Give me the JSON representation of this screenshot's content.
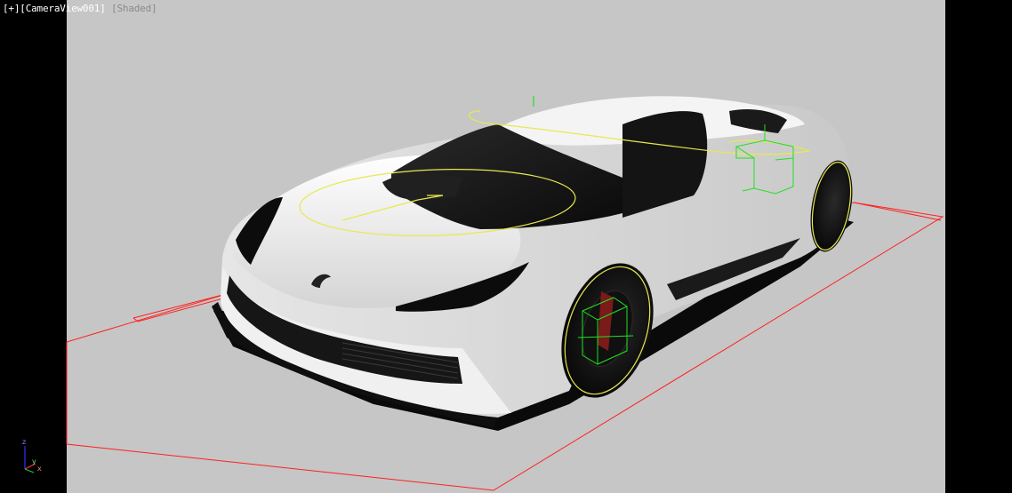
{
  "viewport": {
    "menu_plus": "[+]",
    "camera_name": "[CameraView001]",
    "shading_mode": "[Shaded]"
  },
  "axis_gizmo": {
    "x_label": "x",
    "y_label": "y",
    "z_label": "z"
  },
  "colors": {
    "viewport_background": "#c6c6c6",
    "outside_safe_frame": "#000000",
    "ground_helper": "#ff2020",
    "selected_spline": "#e8e850",
    "gizmo_helper": "#20e020",
    "car_body": "#eeeeee",
    "glass": "#111111"
  }
}
